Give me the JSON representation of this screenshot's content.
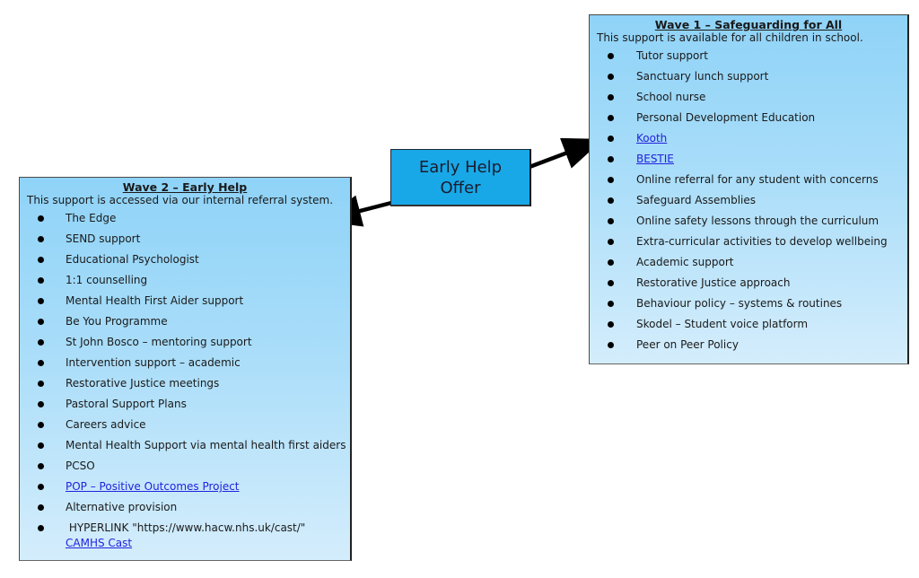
{
  "center": {
    "line1": "Early Help",
    "line2": "Offer"
  },
  "wave1": {
    "title": "Wave 1 – Safeguarding for All",
    "intro": "This support is available for all children in school.",
    "items": [
      {
        "text": "Tutor support",
        "link": false
      },
      {
        "text": "Sanctuary lunch support",
        "link": false
      },
      {
        "text": "School nurse",
        "link": false
      },
      {
        "text": "Personal Development Education",
        "link": false
      },
      {
        "text": "Kooth",
        "link": true
      },
      {
        "text": "BESTIE",
        "link": true
      },
      {
        "text": "Online referral for any student with concerns",
        "link": false
      },
      {
        "text": "Safeguard Assemblies",
        "link": false
      },
      {
        "text": "Online safety lessons through the curriculum",
        "link": false
      },
      {
        "text": "Extra-curricular activities to develop wellbeing",
        "link": false
      },
      {
        "text": "Academic support",
        "link": false
      },
      {
        "text": "Restorative Justice approach",
        "link": false
      },
      {
        "text": "Behaviour policy – systems & routines",
        "link": false
      },
      {
        "text": "Skodel – Student voice platform",
        "link": false
      },
      {
        "text": "Peer on Peer Policy",
        "link": false
      }
    ]
  },
  "wave2": {
    "title": "Wave 2 – Early Help",
    "intro": "This support is accessed via our internal referral system.",
    "items": [
      {
        "text": "The Edge",
        "link": false
      },
      {
        "text": "SEND support",
        "link": false
      },
      {
        "text": "Educational Psychologist",
        "link": false
      },
      {
        "text": "1:1 counselling",
        "link": false
      },
      {
        "text": "Mental Health First Aider support",
        "link": false
      },
      {
        "text": "Be You Programme",
        "link": false
      },
      {
        "text": "St John Bosco – mentoring support",
        "link": false
      },
      {
        "text": "Intervention support – academic",
        "link": false
      },
      {
        "text": "Restorative Justice meetings",
        "link": false
      },
      {
        "text": "Pastoral Support Plans",
        "link": false
      },
      {
        "text": "Careers advice",
        "link": false
      },
      {
        "text": "Mental Health Support via mental health first aiders",
        "link": false
      },
      {
        "text": "PCSO",
        "link": false
      },
      {
        "text": "POP – Positive Outcomes Project",
        "link": true
      },
      {
        "text": "Alternative provision",
        "link": false
      }
    ],
    "last_item": {
      "prefix": " HYPERLINK \"https://www.hacw.nhs.uk/cast/\"",
      "link_text": "CAMHS Cast"
    }
  },
  "colors": {
    "panel_top": "#8fd3f8",
    "panel_bottom": "#d4edfc",
    "center_fill": "#18a8e8",
    "link": "#2222dd",
    "arrow": "#000000"
  }
}
